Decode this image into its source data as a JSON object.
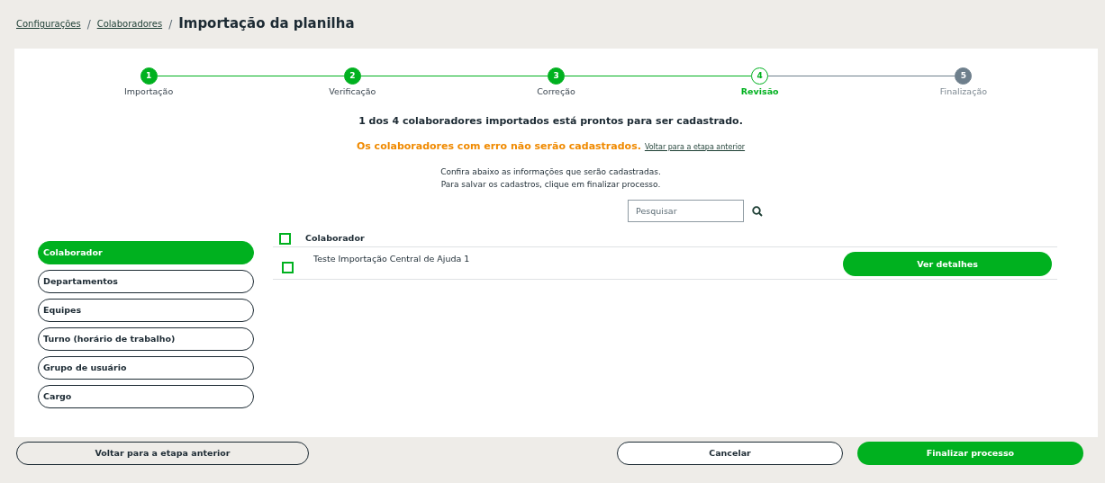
{
  "breadcrumb": {
    "links": [
      "Configurações",
      "Colaboradores"
    ],
    "separators": [
      "/",
      "/"
    ],
    "title": "Importação da planilha"
  },
  "steps": [
    {
      "number": "1",
      "label": "Importação",
      "kind": "done"
    },
    {
      "number": "2",
      "label": "Verificação",
      "kind": "done"
    },
    {
      "number": "3",
      "label": "Correção",
      "kind": "done"
    },
    {
      "number": "4",
      "label": "Revisão",
      "kind": "current"
    },
    {
      "number": "5",
      "label": "Finalização",
      "kind": "pending"
    }
  ],
  "summary": "1 dos 4 colaboradores importados está prontos para ser cadastrado.",
  "warning": {
    "text": "Os colaboradores com erro não serão cadastrados.",
    "link": "Voltar para a etapa anterior"
  },
  "instructions": [
    "Confira abaixo as informações que serão cadastradas.",
    "Para salvar os cadastros, clique em finalizar processo."
  ],
  "search": {
    "placeholder": "Pesquisar"
  },
  "sidebar": {
    "items": [
      {
        "label": "Colaborador",
        "selected": true
      },
      {
        "label": "Departamentos",
        "selected": false
      },
      {
        "label": "Equipes",
        "selected": false
      },
      {
        "label": "Turno (horário de trabalho)",
        "selected": false
      },
      {
        "label": "Grupo de usuário",
        "selected": false
      },
      {
        "label": "Cargo",
        "selected": false
      }
    ]
  },
  "table": {
    "header": {
      "label": "Colaborador",
      "checked": false
    },
    "rows": [
      {
        "name": "Teste Importação Central de Ajuda 1",
        "checked": false,
        "action": "Ver detalhes"
      }
    ]
  },
  "footer": {
    "back": "Voltar para a etapa anterior",
    "cancel": "Cancelar",
    "finish": "Finalizar processo"
  }
}
